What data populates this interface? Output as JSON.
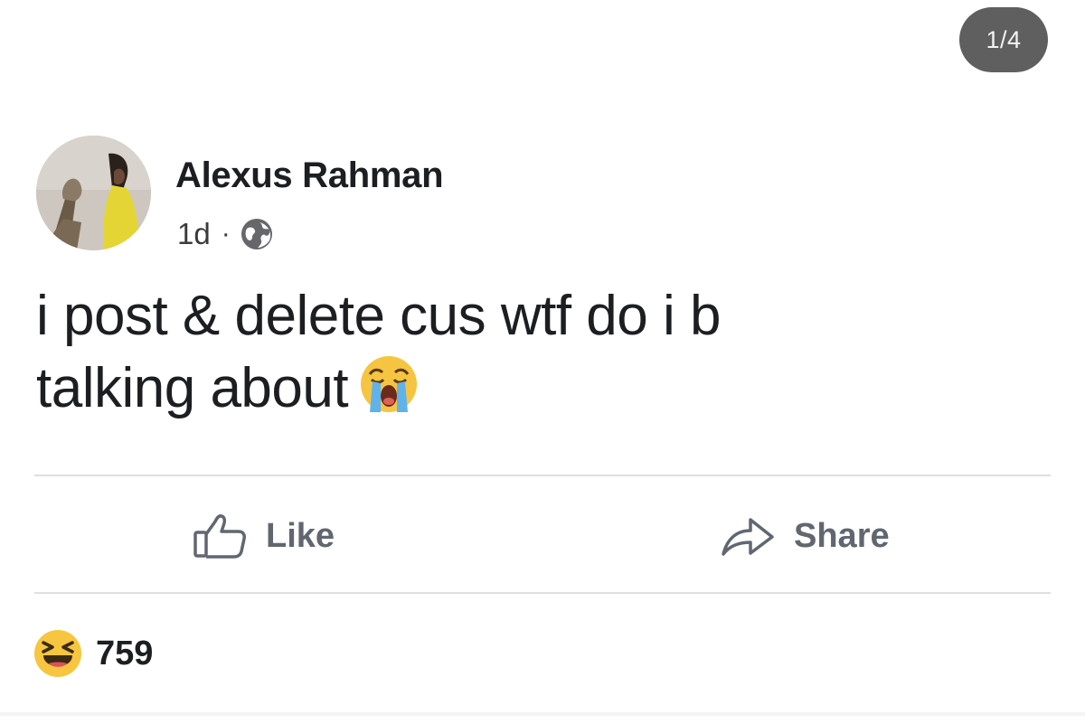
{
  "viewer": {
    "page_counter": "1/4"
  },
  "post": {
    "author_name": "Alexus Rahman",
    "timestamp": "1d",
    "separator": "·",
    "privacy_icon": "globe-icon",
    "text_line1": "i post & delete cus wtf do i b",
    "text_line2": "talking about",
    "text_emoji": "loudly-crying-face-emoji"
  },
  "actions": {
    "like_label": "Like",
    "share_label": "Share"
  },
  "reactions": {
    "icon": "haha-reaction-icon",
    "count": "759"
  },
  "colors": {
    "counter_bg": "#5f5f5f",
    "action_text": "#606770",
    "divider": "#dddfe2",
    "text": "#1c1e21"
  }
}
